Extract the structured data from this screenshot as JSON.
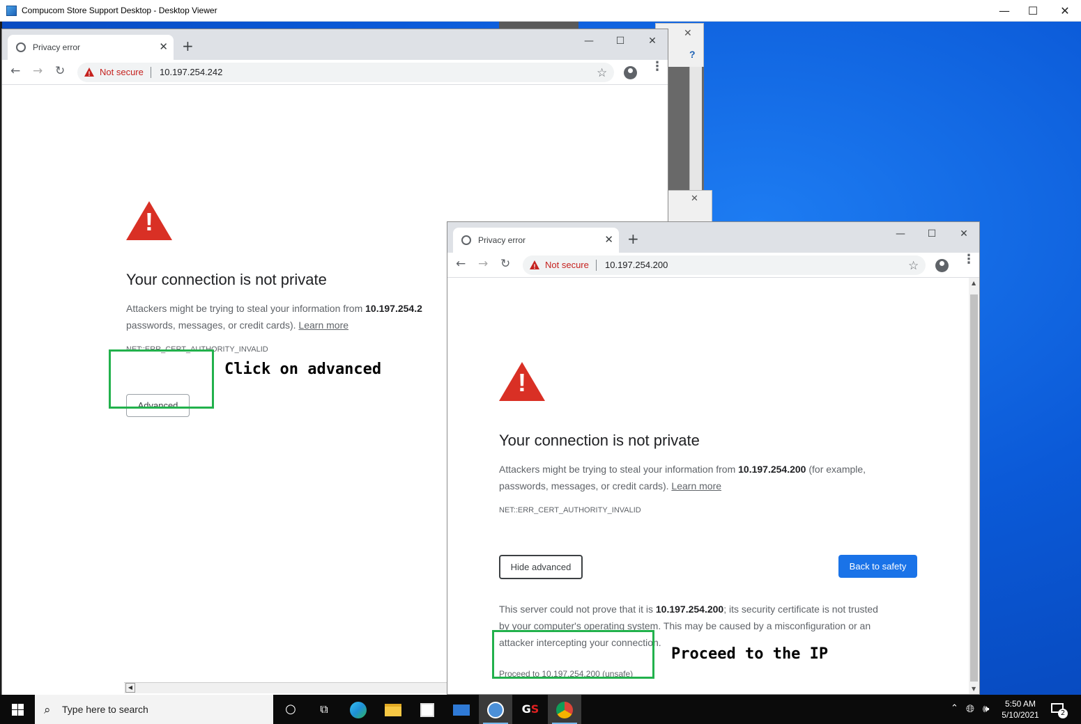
{
  "viewer": {
    "title": "Compucom Store Support Desktop - Desktop Viewer",
    "minimize": "—",
    "maximize": "☐",
    "close": "✕"
  },
  "browser_back": {
    "tab_title": "Privacy error",
    "url": "10.197.254.242",
    "not_secure": "Not secure",
    "heading": "Your connection is not private",
    "para_prefix": "Attackers might be trying to steal your information from ",
    "para_host": "10.197.254.2",
    "para_line2": "passwords, messages, or credit cards). ",
    "learn_more": "Learn more",
    "error_code": "NET::ERR_CERT_AUTHORITY_INVALID",
    "advanced_button": "Advanced"
  },
  "browser_front": {
    "tab_title": "Privacy error",
    "url": "10.197.254.200",
    "not_secure": "Not secure",
    "heading": "Your connection is not private",
    "para_prefix": "Attackers might be trying to steal your information from ",
    "para_host": "10.197.254.200",
    "para_suffix": " (for example,",
    "para_line2": "passwords, messages, or credit cards). ",
    "learn_more": "Learn more",
    "error_code": "NET::ERR_CERT_AUTHORITY_INVALID",
    "hide_advanced_button": "Hide advanced",
    "back_to_safety_button": "Back to safety",
    "detail_prefix": "This server could not prove that it is ",
    "detail_host": "10.197.254.200",
    "detail_line1_suffix": "; its security certificate is not trusted",
    "detail_line2": "by your computer's operating system. This may be caused by a misconfiguration or an",
    "detail_line3": "attacker intercepting your connection.",
    "proceed_link": "Proceed to 10.197.254.200 (unsafe)"
  },
  "annotations": {
    "click_advanced": "Click on advanced",
    "proceed_ip": "Proceed to the IP"
  },
  "taskbar": {
    "search_placeholder": "Type here to search",
    "time": "5:50 AM",
    "date": "5/10/2021",
    "notification_count": "2",
    "icons": [
      "cortana-icon",
      "task-view-icon",
      "edge-icon",
      "file-explorer-icon",
      "store-icon",
      "mail-icon",
      "citrix-icon",
      "gs-icon",
      "chrome-icon"
    ]
  },
  "colors": {
    "warning_red": "#d93025",
    "not_secure_red": "#c5221f",
    "blue_button": "#1a73e8",
    "annotation_green": "#22b14c",
    "desktop_blue": "#0b5ad8"
  }
}
